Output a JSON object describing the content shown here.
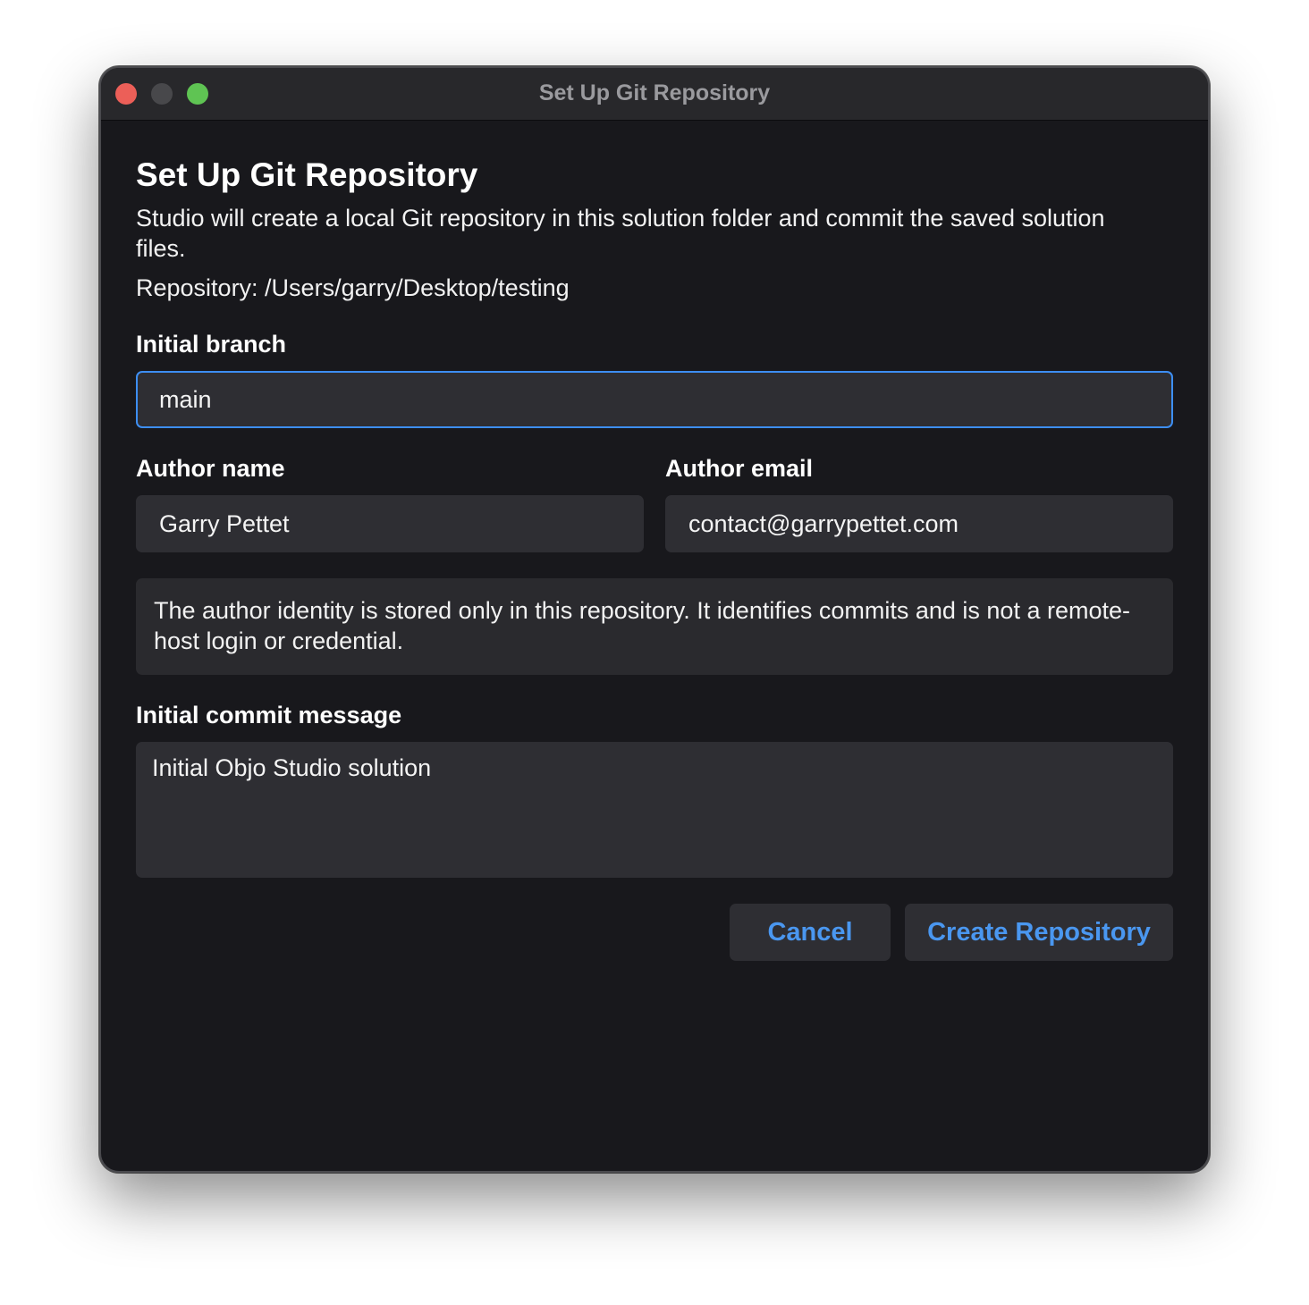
{
  "window": {
    "title": "Set Up Git Repository"
  },
  "dialog": {
    "heading": "Set Up Git Repository",
    "description": "Studio will create a local Git repository in this solution folder and commit the saved solution files.",
    "repository_line": "Repository: /Users/garry/Desktop/testing"
  },
  "form": {
    "initial_branch": {
      "label": "Initial branch",
      "value": "main"
    },
    "author_name": {
      "label": "Author name",
      "value": "Garry Pettet"
    },
    "author_email": {
      "label": "Author email",
      "value": "contact@garrypettet.com"
    },
    "identity_note": "The author identity is stored only in this repository. It identifies commits and is not a remote-host login or credential.",
    "commit_message": {
      "label": "Initial commit message",
      "value": "Initial Objo Studio solution"
    }
  },
  "actions": {
    "cancel_label": "Cancel",
    "create_label": "Create Repository"
  },
  "colors": {
    "accent": "#3d8ef2",
    "button_text": "#4a97f0",
    "window_bg": "#18181c",
    "field_bg": "#2e2e33",
    "close": "#ec5f58",
    "minimize": "#48484b",
    "zoom": "#5fc453"
  }
}
